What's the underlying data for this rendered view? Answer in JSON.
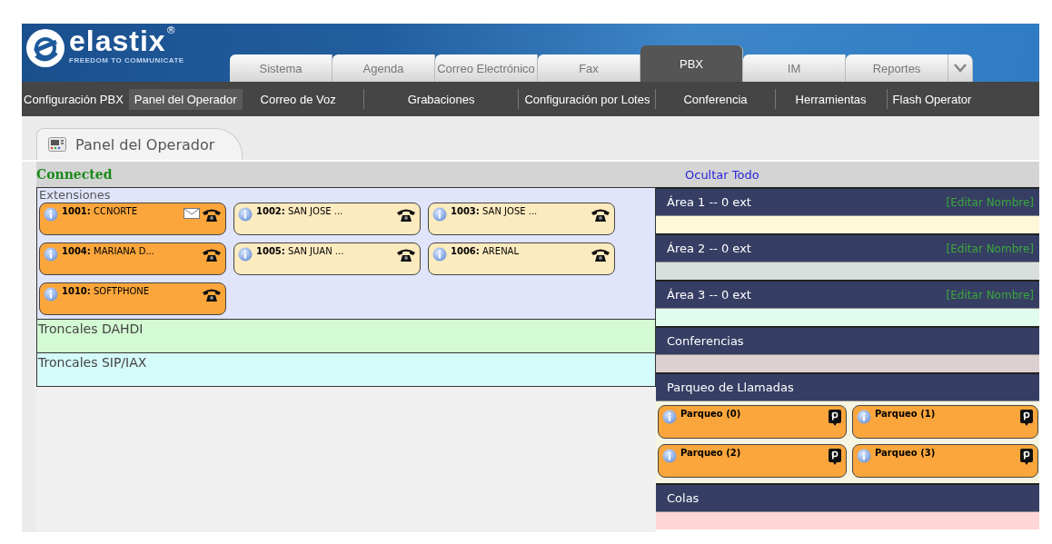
{
  "logo": {
    "name": "elastix",
    "mark": "®",
    "tagline": "FREEDOM TO COMMUNICATE"
  },
  "tabs": [
    {
      "label": "Sistema",
      "selected": false
    },
    {
      "label": "Agenda",
      "selected": false
    },
    {
      "label": "Correo Electrónico",
      "selected": false
    },
    {
      "label": "Fax",
      "selected": false
    },
    {
      "label": "PBX",
      "selected": true
    },
    {
      "label": "IM",
      "selected": false
    },
    {
      "label": "Reportes",
      "selected": false
    }
  ],
  "submenu": [
    {
      "label": "Configuración PBX",
      "selected": false
    },
    {
      "label": "Panel del Operador",
      "selected": true
    },
    {
      "label": "Correo de Voz",
      "selected": false
    },
    {
      "label": "Grabaciones",
      "selected": false
    },
    {
      "label": "Configuración por Lotes",
      "selected": false
    },
    {
      "label": "Conferencia",
      "selected": false
    },
    {
      "label": "Herramientas",
      "selected": false
    },
    {
      "label": "Flash Operator",
      "selected": false
    }
  ],
  "module_tab": {
    "title": "Panel del Operador"
  },
  "status": "Connected",
  "hide_all": "Ocultar Todo",
  "extensions": {
    "title": "Extensiones",
    "items": [
      {
        "label": "**1001:** CCNORTE",
        "busy": true,
        "voicemail": true
      },
      {
        "label": "**1002:** SAN JOSE ...",
        "busy": false,
        "voicemail": false
      },
      {
        "label": "**1003:** SAN JOSE ...",
        "busy": false,
        "voicemail": false
      },
      {
        "label": "**1004:** MARIANA D...",
        "busy": true,
        "voicemail": false
      },
      {
        "label": "**1005:** SAN JUAN ...",
        "busy": false,
        "voicemail": false
      },
      {
        "label": "**1006:** ARENAL",
        "busy": false,
        "voicemail": false
      },
      {
        "label": "**1010:** SOFTPHONE",
        "busy": true,
        "voicemail": false
      }
    ]
  },
  "trunk_groups": [
    {
      "title": "Troncales DAHDI",
      "color": "#d3fad3"
    },
    {
      "title": "Troncales SIP/IAX",
      "color": "#d5fafa"
    }
  ],
  "sections": [
    {
      "kind": "area",
      "title": "Área 1 -- 0 ext",
      "edit_link": "[Editar Nombre]",
      "color": "#fff8d8"
    },
    {
      "kind": "area",
      "title": "Área 2 -- 0 ext",
      "edit_link": "[Editar Nombre]",
      "color": "#d8dfdc"
    },
    {
      "kind": "area",
      "title": "Área 3 -- 0 ext",
      "edit_link": "[Editar Nombre]",
      "color": "#e0fcee"
    },
    {
      "kind": "group",
      "title": "Conferencias",
      "color": "#dcd0d0"
    },
    {
      "kind": "parking",
      "title": "Parqueo de Llamadas",
      "color": "#f6f5e2",
      "slots": [
        "Parqueo (0)",
        "Parqueo (1)",
        "Parqueo (2)",
        "Parqueo (3)"
      ]
    },
    {
      "kind": "group",
      "title": "Colas",
      "color": "#ffd6d6"
    }
  ]
}
